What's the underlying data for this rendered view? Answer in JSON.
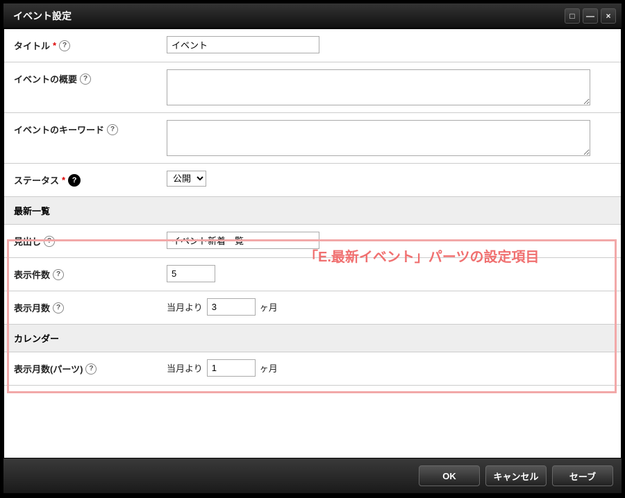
{
  "dialog": {
    "title": "イベント設定"
  },
  "fields": {
    "title": {
      "label": "タイトル",
      "value": "イベント"
    },
    "summary": {
      "label": "イベントの概要",
      "value": ""
    },
    "keywords": {
      "label": "イベントのキーワード",
      "value": ""
    },
    "status": {
      "label": "ステータス",
      "selected": "公開"
    }
  },
  "section_latest": {
    "header": "最新一覧",
    "heading": {
      "label": "見出し",
      "value": "イベント新着一覧"
    },
    "count": {
      "label": "表示件数",
      "value": "5"
    },
    "months": {
      "label": "表示月数",
      "prefix": "当月より",
      "value": "3",
      "suffix": "ヶ月"
    }
  },
  "section_calendar": {
    "header": "カレンダー",
    "months": {
      "label": "表示月数(パーツ)",
      "prefix": "当月より",
      "value": "1",
      "suffix": "ヶ月"
    }
  },
  "annotation": "「E.最新イベント」パーツの設定項目",
  "buttons": {
    "ok": "OK",
    "cancel": "キャンセル",
    "save": "セーブ"
  }
}
